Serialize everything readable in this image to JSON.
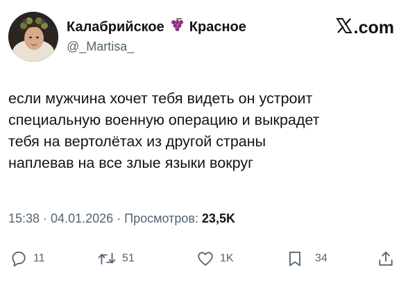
{
  "author": {
    "display_name_part1": "Калабрийское",
    "emoji_icon": "grapes-icon",
    "display_name_part2": "Красное",
    "handle": "@_Martisa_"
  },
  "brand": {
    "logo_icon": "x-logo-icon",
    "suffix": ".com"
  },
  "tweet": {
    "lines": [
      "если мужчина хочет тебя видеть он устроит",
      "специальную военную операцию и выкрадет",
      "тебя на вертолётах из другой страны",
      "наплевав на все злые языки вокруг"
    ]
  },
  "meta": {
    "time": "15:38",
    "sep1": " · ",
    "date": "04.01.2026",
    "sep2": " · ",
    "views_label": "Просмотров: ",
    "views_count": "23,5K"
  },
  "actions": {
    "reply": {
      "icon": "reply-icon",
      "count": "11"
    },
    "repost": {
      "icon": "repost-icon",
      "count": "51"
    },
    "like": {
      "icon": "heart-icon",
      "count": "1K"
    },
    "bookmark": {
      "icon": "bookmark-icon",
      "count": "34"
    },
    "share": {
      "icon": "share-icon"
    }
  },
  "colors": {
    "text_primary": "#0f1419",
    "text_secondary": "#536471",
    "grape": "#8e2c7e"
  }
}
